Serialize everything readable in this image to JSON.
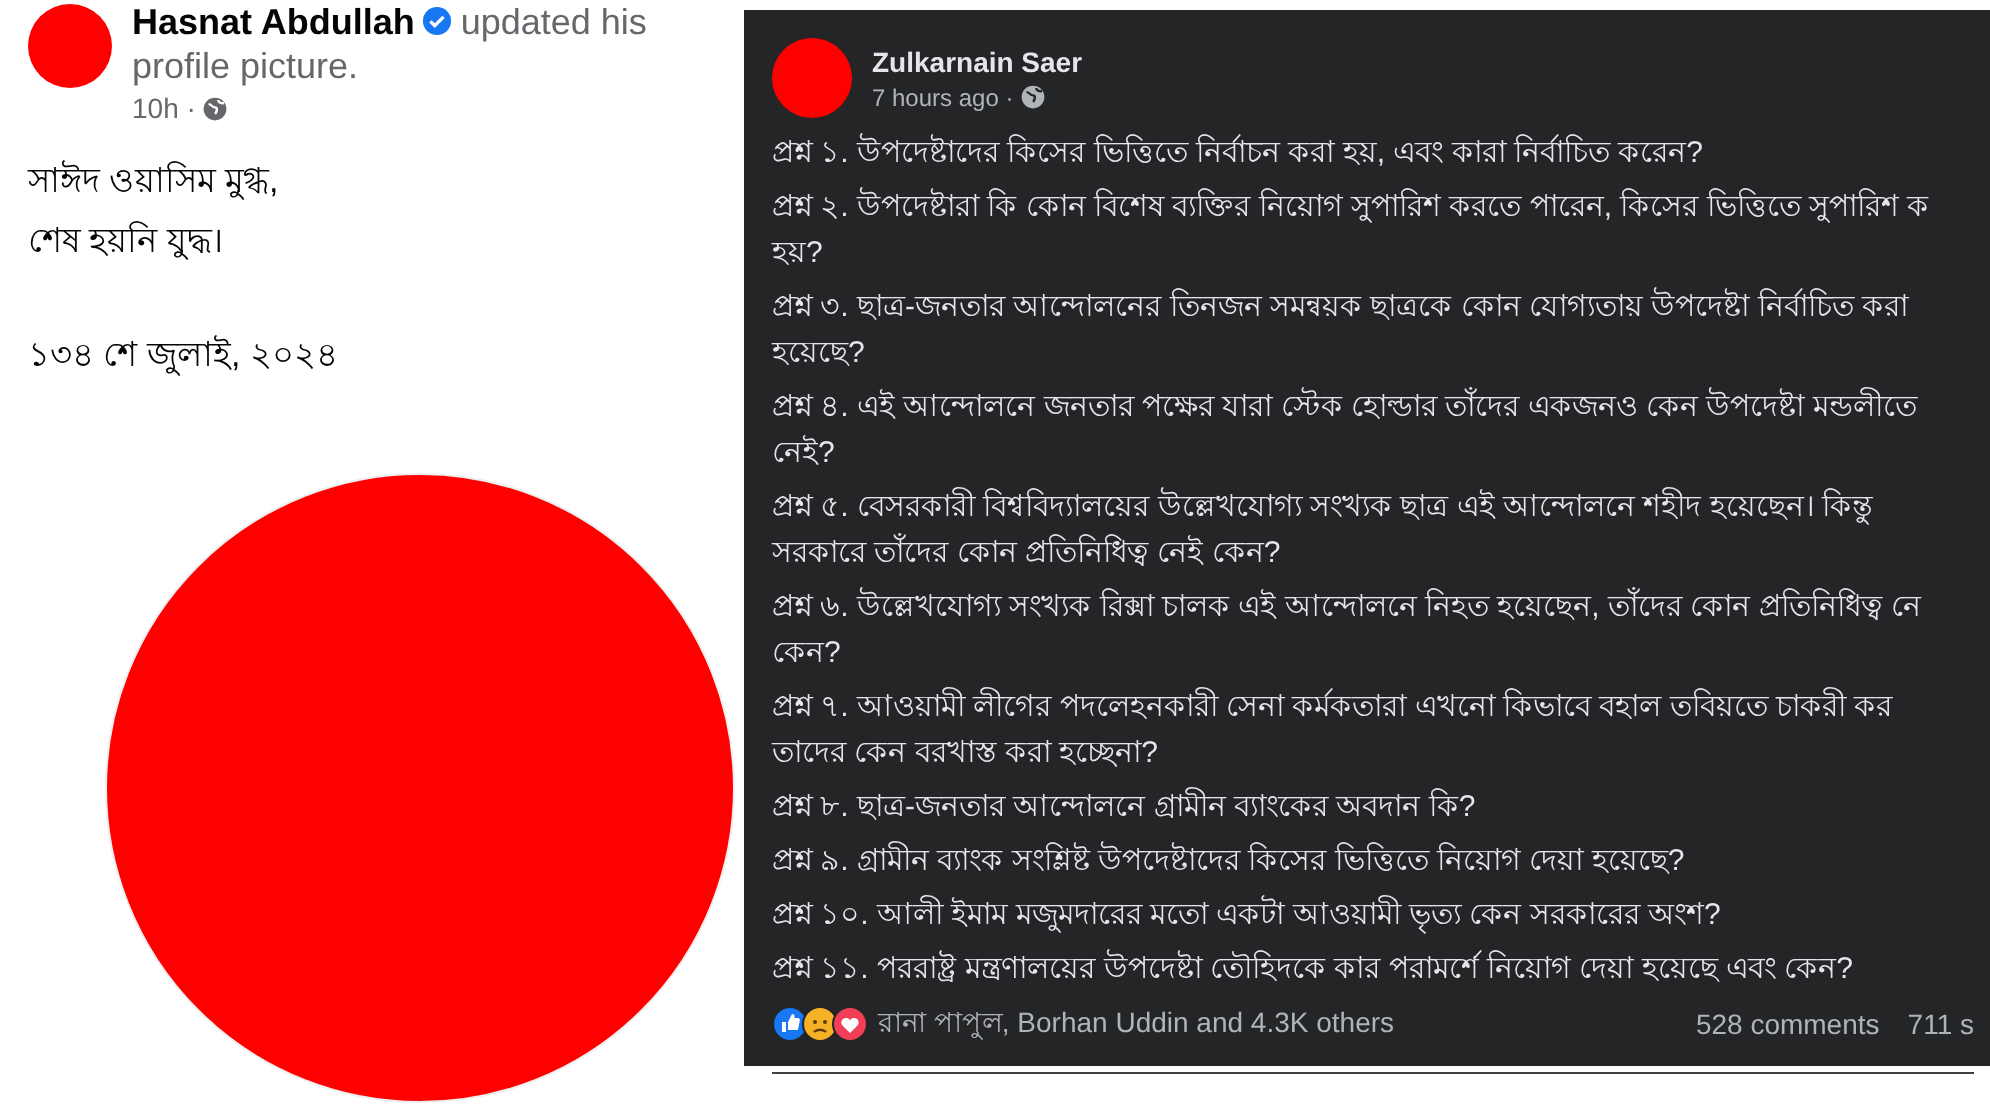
{
  "left_post": {
    "author": "Hasnat Abdullah",
    "verified": true,
    "action": "updated his profile picture.",
    "time": "10h ·",
    "body_lines": [
      "সাঈদ ওয়াসিম মুগ্ধ,",
      "শেষ হয়নি যুদ্ধ।"
    ],
    "date_line": "১৩৪ শে জুলাই, ২০২৪"
  },
  "right_post": {
    "author": "Zulkarnain Saer",
    "time": "7 hours ago ·",
    "questions": [
      {
        "lines": [
          "প্রশ্ন ১. উপদেষ্টাদের কিসের ভিত্তিতে নির্বাচন করা হয়, এবং কারা নির্বাচিত করেন?"
        ]
      },
      {
        "lines": [
          "প্রশ্ন ২. উপদেষ্টারা কি কোন বিশেষ ব্যক্তির নিয়োগ সুপারিশ করতে পারেন, কিসের ভিত্তিতে সুপারিশ ক",
          "হয়?"
        ]
      },
      {
        "lines": [
          "প্রশ্ন ৩. ছাত্র-জনতার আন্দোলনের তিনজন সমন্বয়ক ছাত্রকে কোন যোগ্যতায় উপদেষ্টা নির্বাচিত করা",
          "হয়েছে?"
        ]
      },
      {
        "lines": [
          "প্রশ্ন ৪. এই আন্দোলনে জনতার পক্ষের যারা স্টেক হোল্ডার তাঁদের একজনও কেন উপদেষ্টা মন্ডলীতে",
          "নেই?"
        ]
      },
      {
        "lines": [
          "প্রশ্ন ৫. বেসরকারী বিশ্ববিদ্যালয়ের উল্লেখযোগ্য সংখ্যক ছাত্র এই আন্দোলনে শহীদ হয়েছেন। কিন্তু",
          "সরকারে তাঁদের কোন প্রতিনিধিত্ব নেই কেন?"
        ]
      },
      {
        "lines": [
          "প্রশ্ন ৬. উল্লেখযোগ্য সংখ্যক রিক্সা চালক এই আন্দোলনে নিহত হয়েছেন, তাঁদের কোন প্রতিনিধিত্ব নে",
          "কেন?"
        ]
      },
      {
        "lines": [
          "প্রশ্ন ৭. আওয়ামী লীগের পদলেহনকারী সেনা কর্মকতারা এখনো কিভাবে বহাল তবিয়তে চাকরী কর",
          "তাদের কেন বরখাস্ত করা হচ্ছেনা?"
        ]
      },
      {
        "lines": [
          "প্রশ্ন ৮. ছাত্র-জনতার আন্দোলনে গ্রামীন ব্যাংকের অবদান কি?"
        ]
      },
      {
        "lines": [
          "প্রশ্ন ৯. গ্রামীন ব্যাংক সংশ্লিষ্ট উপদেষ্টাদের কিসের ভিত্তিতে নিয়োগ দেয়া হয়েছে?"
        ]
      },
      {
        "lines": [
          "প্রশ্ন ১০. আলী ইমাম মজুমদারের মতো একটা আওয়ামী ভৃত্য কেন সরকারের অংশ?"
        ]
      },
      {
        "lines": [
          "প্রশ্ন ১১. পররাষ্ট্র মন্ত্রণালয়ের উপদেষ্টা তৌহিদকে কার পরামর্শে নিয়োগ দেয়া হয়েছে এবং কেন?"
        ]
      }
    ],
    "reactions": {
      "icons": [
        {
          "kind": "like"
        },
        {
          "kind": "sad"
        },
        {
          "kind": "love"
        }
      ],
      "summary": "রানা পাপুল, Borhan Uddin and 4.3K others"
    },
    "comments": "528 comments",
    "shares": "711 s"
  }
}
